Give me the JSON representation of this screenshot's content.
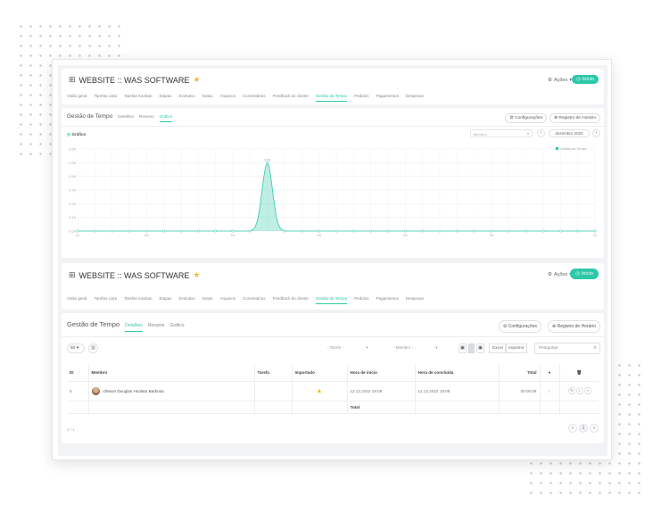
{
  "app": {
    "grid_icon": "⊞",
    "title": "WEBSITE :: WAS SOFTWARE",
    "acoes_label": "Ações",
    "inicio_label": "Início",
    "star_icon": "★"
  },
  "tabs": [
    "Visão geral",
    "Tarefas Lista",
    "Tarefas Kanban",
    "Etapas",
    "Evolutivo",
    "Notas",
    "Arquivos",
    "Comentários",
    "Feedback do cliente",
    "Gestão de Tempo",
    "Pedidos",
    "Pagamentos",
    "Despesas"
  ],
  "active_tab": "Gestão de Tempo",
  "chart_section": {
    "title": "Gestão de Tempo",
    "subtabs": [
      "Detalhes",
      "Resumo",
      "Gráfico"
    ],
    "active_subtab": "Gráfico",
    "config_label": "Configurações",
    "registro_label": "Registro de Horário",
    "grafico_label": "Gráfico",
    "membro_placeholder": "Membro",
    "month_label": "dezembro 2022",
    "legend_label": "Gestão de Tempo"
  },
  "chart_data": {
    "type": "area",
    "ylim": [
      0,
      0.6
    ],
    "yticks": [
      "0.60",
      "0.50",
      "0.40",
      "0.30",
      "0.20",
      "0.10",
      "0.00"
    ],
    "xticks": [
      "01",
      "05",
      "10",
      "15",
      "20",
      "25",
      "31"
    ],
    "x": [
      1,
      2,
      3,
      4,
      5,
      6,
      7,
      8,
      9,
      10,
      11,
      12,
      13,
      14,
      15,
      16,
      17,
      18,
      19,
      20,
      21,
      22,
      23,
      24,
      25,
      26,
      27,
      28,
      29,
      30,
      31
    ],
    "series": [
      {
        "name": "Gestão de Tempo",
        "values": [
          0,
          0,
          0,
          0,
          0,
          0,
          0,
          0,
          0,
          0,
          0,
          0.5,
          0,
          0,
          0,
          0,
          0,
          0,
          0,
          0,
          0,
          0,
          0,
          0,
          0,
          0,
          0,
          0,
          0,
          0,
          0
        ]
      }
    ],
    "peak_label": "0.50",
    "color": "#2cc8a8",
    "grid": true,
    "legend": "top-right"
  },
  "table_section": {
    "title": "Gestão de Tempo",
    "subtabs": [
      "Detalhes",
      "Resumo",
      "Gráfico"
    ],
    "active_subtab": "Detalhes",
    "config_label": "Configurações",
    "registro_label": "Registro de Horário",
    "page_size": "50",
    "tarefa_filter": "- Tarefa -",
    "membro_filter": "- Membro -",
    "excel_label": "Excel",
    "imprimir_label": "Imprimir",
    "search_placeholder": "Pesquisar",
    "columns": [
      "ID",
      "Membro",
      "Tarefa",
      "Importado",
      "Hora de início",
      "Hora de concluída",
      "Total"
    ],
    "rows": [
      {
        "id": "5",
        "membro": "Oleson Douglas Hoolato Barbosa",
        "tarefa": "",
        "inicio": "12.12.2022 19:08",
        "fim": "12.12.2022 19:08",
        "total": "00:00:06"
      }
    ],
    "total_label": "Total",
    "footer_info": "1 / 1",
    "current_page": "1"
  }
}
